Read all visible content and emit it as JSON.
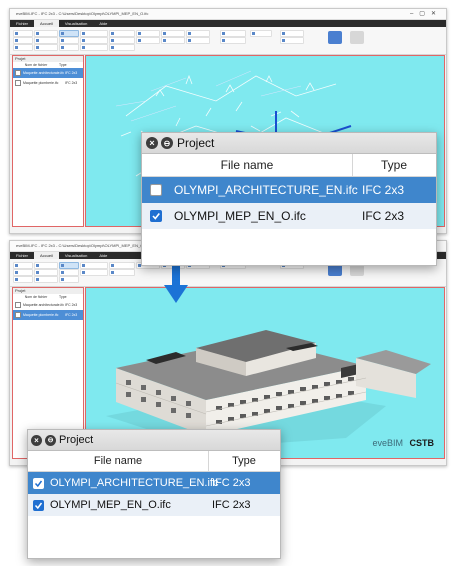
{
  "window": {
    "title": "eveBIM-IFC - IFC 2x3 - C:\\Users\\Desktop\\Olympi\\OLYMPI_MEP_EN_O.ifc",
    "menu": [
      "Fichier",
      "Accueil",
      "Visualisation",
      "Aide"
    ],
    "active_menu": 1,
    "panel_title": "Projet",
    "panel_col_name": "Nom de fichier",
    "panel_col_type": "Type",
    "panel_files": [
      {
        "name": "Maquette architecturale.ifc",
        "type": "IFC 2x3"
      },
      {
        "name": "Maquette plomberie.ifc",
        "type": "IFC 2x3"
      }
    ],
    "status_text": "Vue : 3D / Zoom 100%"
  },
  "brand": "eveBIM",
  "brand_suffix": "CSTB",
  "dialog_top": {
    "title": "Project",
    "col_file": "File name",
    "col_type": "Type",
    "rows": [
      {
        "name": "OLYMPI_ARCHITECTURE_EN.ifc",
        "type": "IFC 2x3",
        "checked": false,
        "selected": true
      },
      {
        "name": "OLYMPI_MEP_EN_O.ifc",
        "type": "IFC 2x3",
        "checked": true,
        "selected": false
      }
    ]
  },
  "dialog_bottom": {
    "title": "Project",
    "col_file": "File name",
    "col_type": "Type",
    "rows": [
      {
        "name": "OLYMPI_ARCHITECTURE_EN.ifc",
        "type": "IFC 2x3",
        "checked": true,
        "selected": true
      },
      {
        "name": "OLYMPI_MEP_EN_O.ifc",
        "type": "IFC 2x3",
        "checked": true,
        "selected": false
      }
    ]
  },
  "colors": {
    "viewport": "#7fe9ef",
    "selection": "#3f86cc",
    "check_blue": "#1f6fd1",
    "arrow": "#1b73d6",
    "highlight_border": "#e06666"
  }
}
